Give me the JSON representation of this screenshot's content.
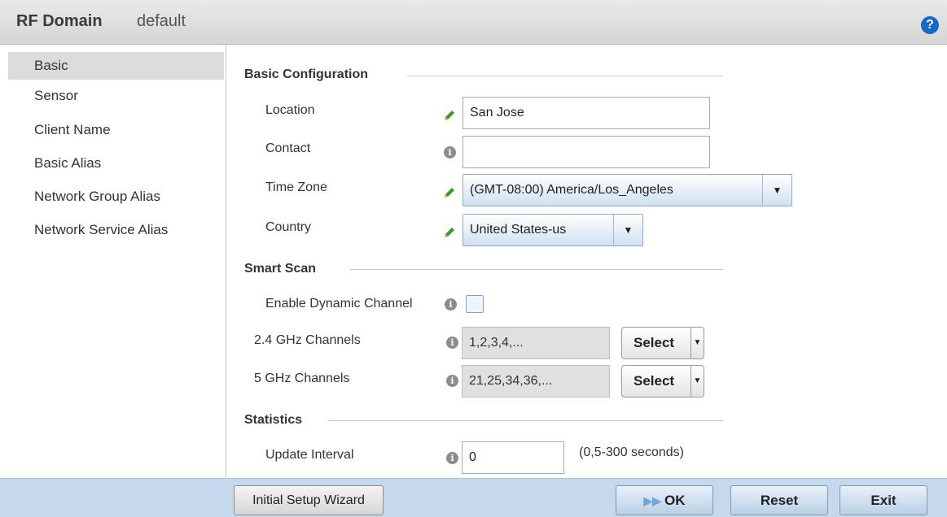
{
  "window": {
    "title": "RF Domain",
    "subtitle": "default",
    "help_icon": "?"
  },
  "sidebar": {
    "items": [
      {
        "label": "Basic"
      },
      {
        "label": "Sensor"
      },
      {
        "label": "Client Name"
      },
      {
        "label": "Basic Alias"
      },
      {
        "label": "Network Group Alias"
      },
      {
        "label": "Network Service Alias"
      }
    ],
    "active_index": 0
  },
  "basic_configuration": {
    "heading": "Basic Configuration",
    "location": {
      "label": "Location",
      "value": "San Jose"
    },
    "contact": {
      "label": "Contact",
      "value": ""
    },
    "time_zone": {
      "label": "Time Zone",
      "value": "(GMT-08:00) America/Los_Angeles"
    },
    "country": {
      "label": "Country",
      "value": "United States-us"
    }
  },
  "smart_scan": {
    "heading": "Smart Scan",
    "dynamic_channel": {
      "label": "Enable Dynamic Channel",
      "checked": false
    },
    "channels_24": {
      "label": "2.4 GHz Channels",
      "value": "1,2,3,4,...",
      "button": "Select"
    },
    "channels_5": {
      "label": "5 GHz Channels",
      "value": "21,25,34,36,...",
      "button": "Select"
    }
  },
  "statistics": {
    "heading": "Statistics",
    "update_interval": {
      "label": "Update Interval",
      "value": "0",
      "hint": "(0,5-300 seconds)"
    }
  },
  "footer": {
    "wizard": "Initial Setup Wizard",
    "ok": "OK",
    "reset": "Reset",
    "exit": "Exit"
  },
  "icons": {
    "dropdown_arrow": "▼",
    "info": "i",
    "edit": "pencil-icon",
    "ok": "double-arrow-icon"
  },
  "colors": {
    "accent_blue": "#1569c7",
    "footer_bg": "#c6d9ec",
    "pencil_green": "#3b9b2a"
  }
}
